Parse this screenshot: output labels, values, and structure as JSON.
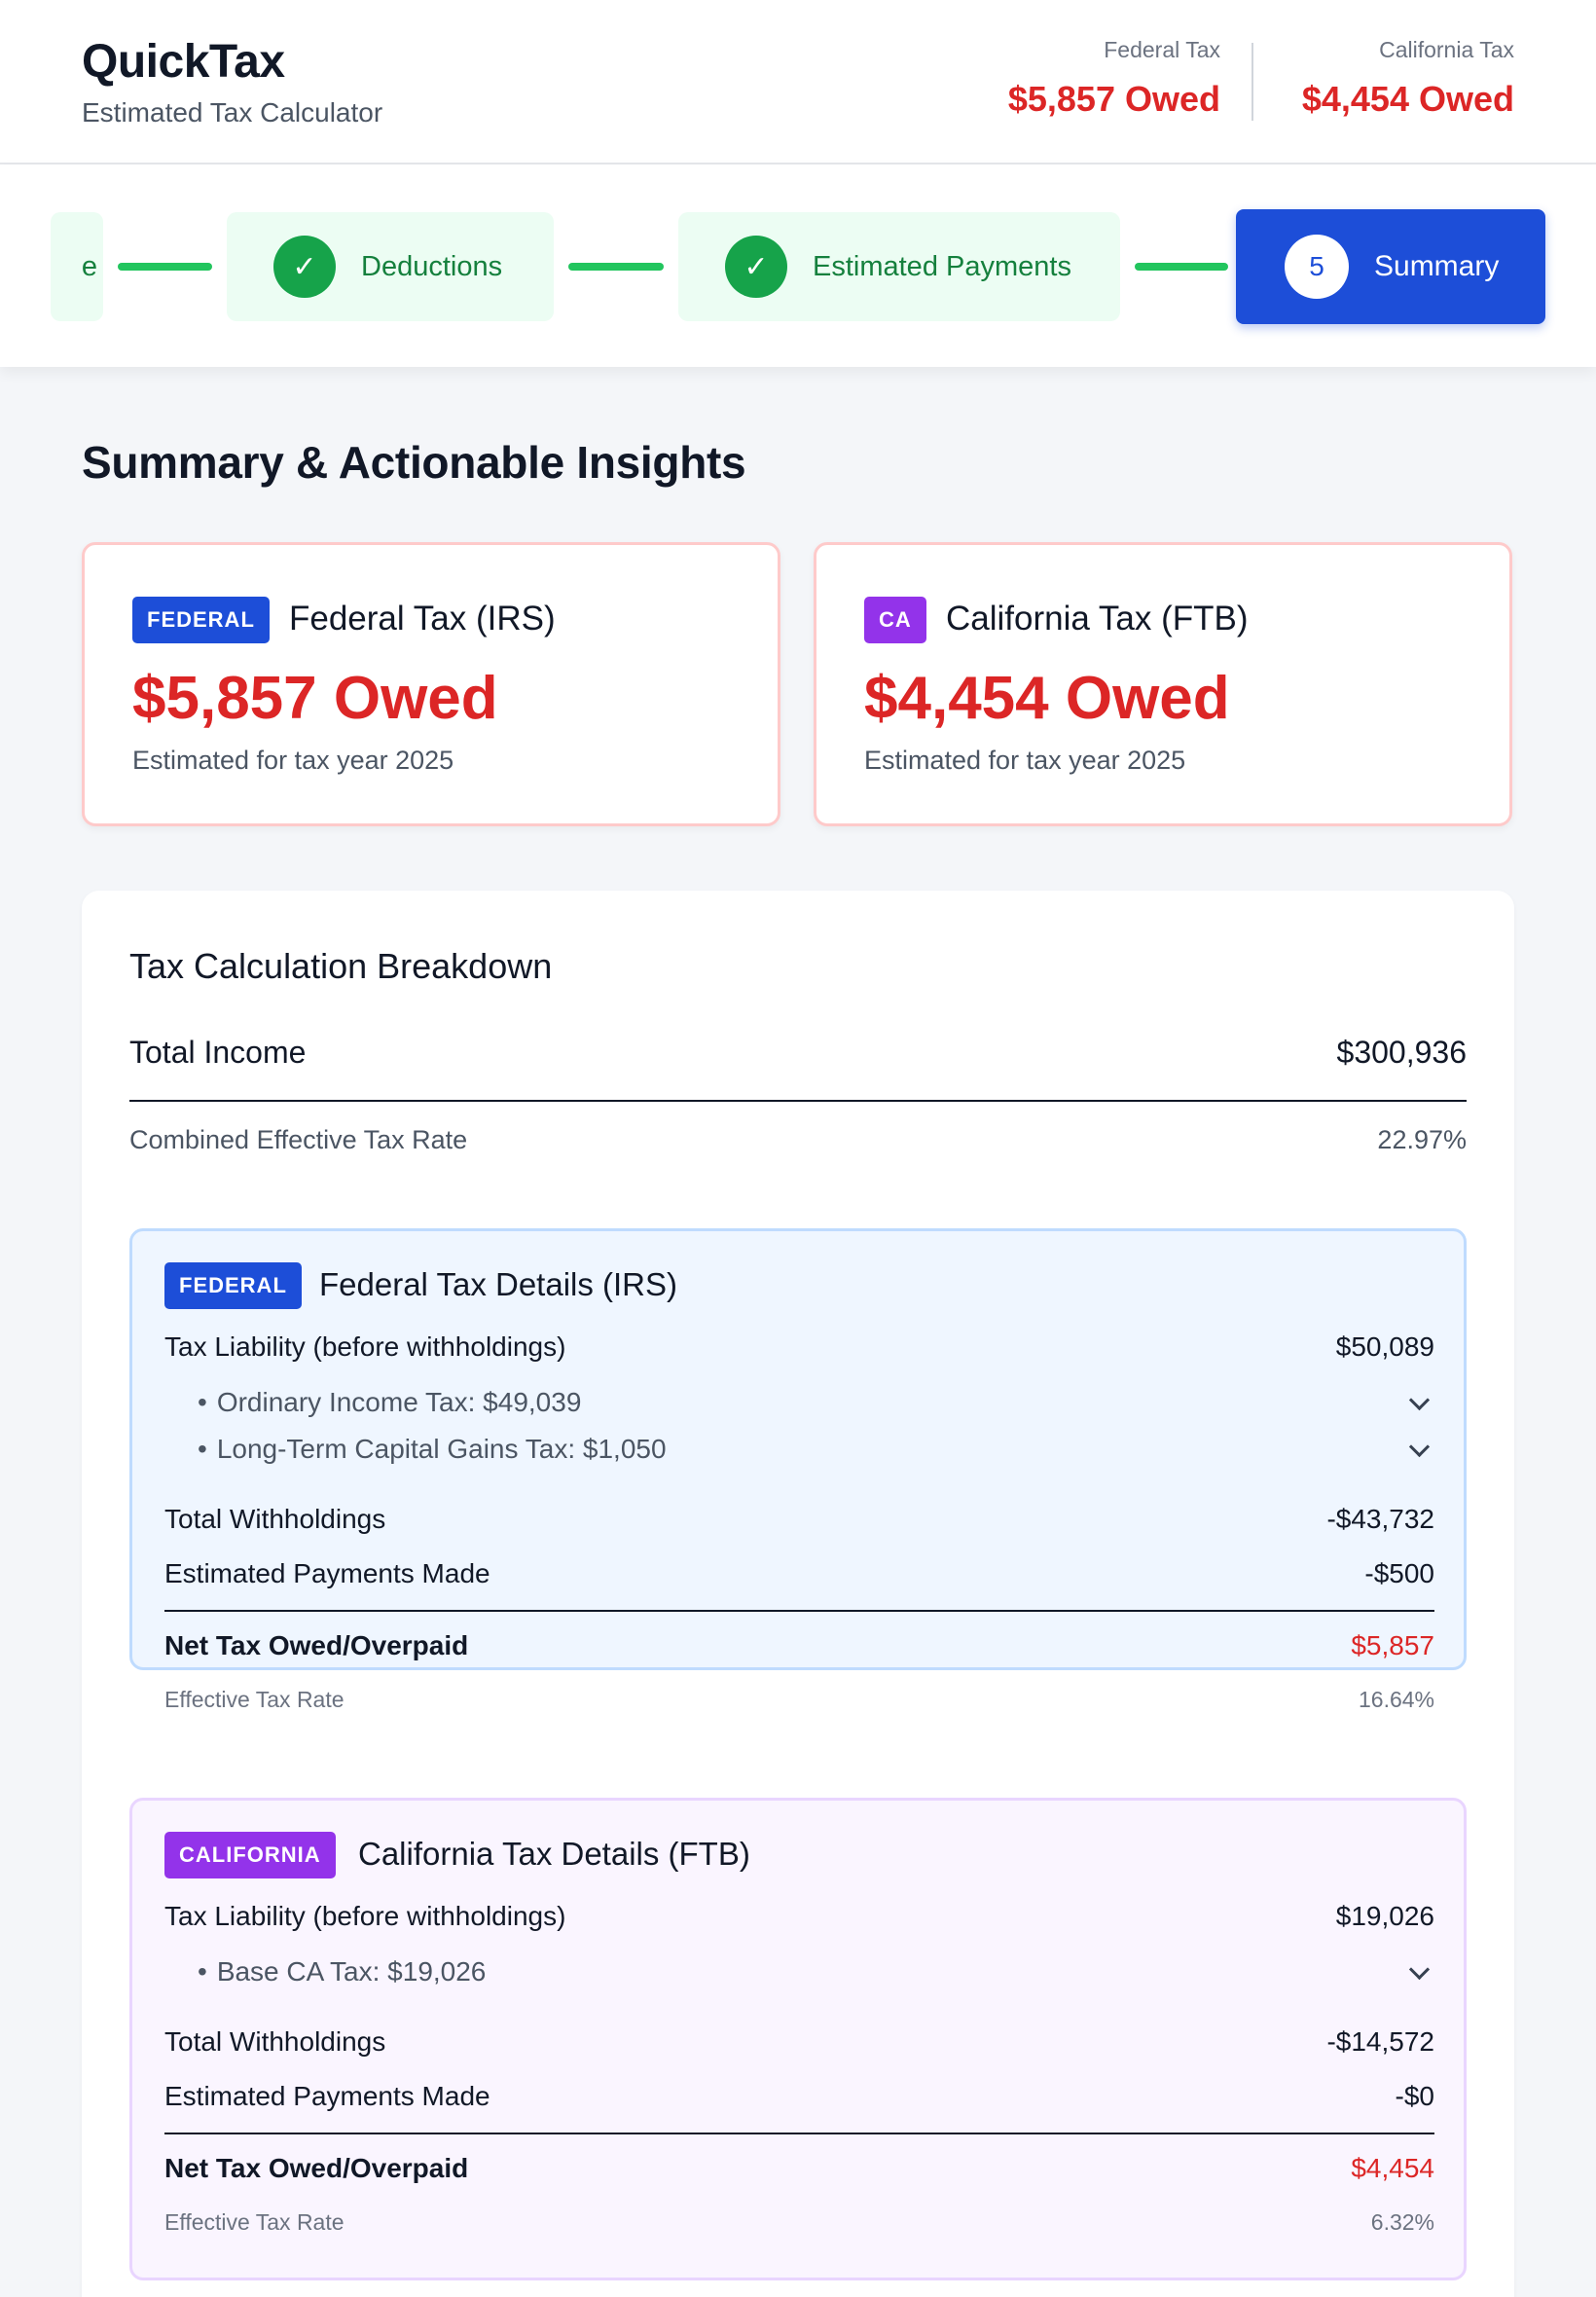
{
  "app": {
    "title": "QuickTax",
    "subtitle": "Estimated Tax Calculator"
  },
  "header_stats": {
    "federal": {
      "label": "Federal Tax",
      "value": "$5,857 Owed"
    },
    "california": {
      "label": "California Tax",
      "value": "$4,454 Owed"
    }
  },
  "stepper": {
    "steps": [
      {
        "label": "e",
        "state": "complete",
        "icon": "check-icon"
      },
      {
        "label": "Deductions",
        "state": "complete",
        "icon": "check-icon"
      },
      {
        "label": "Estimated Payments",
        "state": "complete",
        "icon": "check-icon"
      },
      {
        "label": "Summary",
        "state": "active",
        "number": "5"
      }
    ]
  },
  "page": {
    "title": "Summary & Actionable Insights"
  },
  "summary_cards": {
    "federal": {
      "badge": "FEDERAL",
      "title": "Federal Tax (IRS)",
      "amount": "$5,857 Owed",
      "note": "Estimated for tax year 2025"
    },
    "california": {
      "badge": "CA",
      "title": "California Tax (FTB)",
      "amount": "$4,454 Owed",
      "note": "Estimated for tax year 2025"
    }
  },
  "breakdown": {
    "title": "Tax Calculation Breakdown",
    "total_income": {
      "label": "Total Income",
      "value": "$300,936"
    },
    "combined_rate": {
      "label": "Combined Effective Tax Rate",
      "value": "22.97%"
    },
    "federal": {
      "badge": "FEDERAL",
      "title": "Federal Tax Details (IRS)",
      "liability": {
        "label": "Tax Liability (before withholdings)",
        "value": "$50,089"
      },
      "sub_items": [
        {
          "label": "Ordinary Income Tax: $49,039"
        },
        {
          "label": "Long-Term Capital Gains Tax: $1,050"
        }
      ],
      "withholdings": {
        "label": "Total Withholdings",
        "value": "-$43,732"
      },
      "est_payments": {
        "label": "Estimated Payments Made",
        "value": "-$500"
      },
      "net": {
        "label": "Net Tax Owed/Overpaid",
        "value": "$5,857"
      },
      "effective_rate": {
        "label": "Effective Tax Rate",
        "value": "16.64%"
      }
    },
    "california": {
      "badge": "CALIFORNIA",
      "title": "California Tax Details (FTB)",
      "liability": {
        "label": "Tax Liability (before withholdings)",
        "value": "$19,026"
      },
      "sub_items": [
        {
          "label": "Base CA Tax: $19,026"
        }
      ],
      "withholdings": {
        "label": "Total Withholdings",
        "value": "-$14,572"
      },
      "est_payments": {
        "label": "Estimated Payments Made",
        "value": "-$0"
      },
      "net": {
        "label": "Net Tax Owed/Overpaid",
        "value": "$4,454"
      },
      "effective_rate": {
        "label": "Effective Tax Rate",
        "value": "6.32%"
      }
    }
  },
  "colors": {
    "primary": "#1d4ed8",
    "success": "#16a34a",
    "owed": "#dc2626",
    "california_accent": "#9333ea"
  }
}
